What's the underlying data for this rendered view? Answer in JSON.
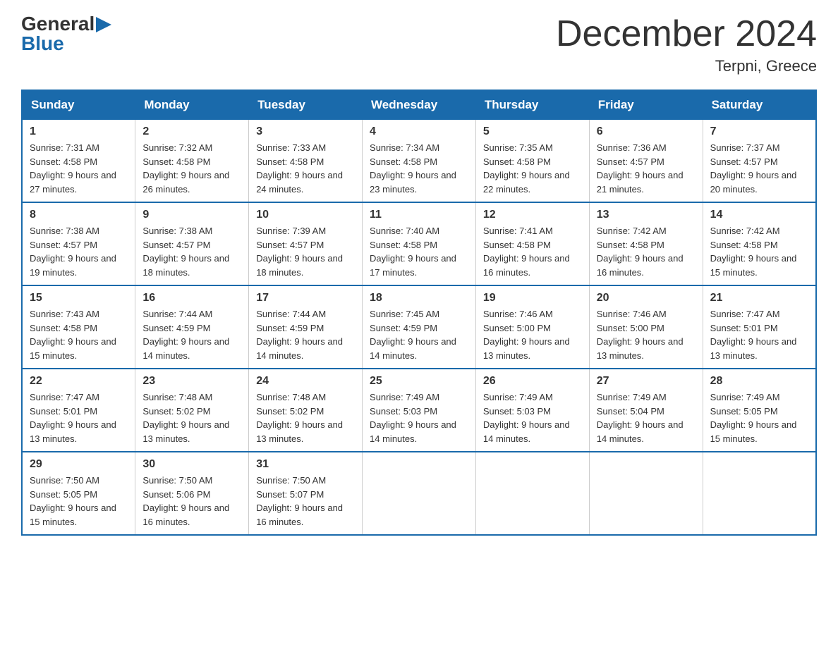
{
  "logo": {
    "general": "General",
    "blue": "Blue",
    "arrow": "▶"
  },
  "title": "December 2024",
  "location": "Terpni, Greece",
  "headers": [
    "Sunday",
    "Monday",
    "Tuesday",
    "Wednesday",
    "Thursday",
    "Friday",
    "Saturday"
  ],
  "weeks": [
    [
      {
        "day": "1",
        "sunrise": "7:31 AM",
        "sunset": "4:58 PM",
        "daylight": "9 hours and 27 minutes."
      },
      {
        "day": "2",
        "sunrise": "7:32 AM",
        "sunset": "4:58 PM",
        "daylight": "9 hours and 26 minutes."
      },
      {
        "day": "3",
        "sunrise": "7:33 AM",
        "sunset": "4:58 PM",
        "daylight": "9 hours and 24 minutes."
      },
      {
        "day": "4",
        "sunrise": "7:34 AM",
        "sunset": "4:58 PM",
        "daylight": "9 hours and 23 minutes."
      },
      {
        "day": "5",
        "sunrise": "7:35 AM",
        "sunset": "4:58 PM",
        "daylight": "9 hours and 22 minutes."
      },
      {
        "day": "6",
        "sunrise": "7:36 AM",
        "sunset": "4:57 PM",
        "daylight": "9 hours and 21 minutes."
      },
      {
        "day": "7",
        "sunrise": "7:37 AM",
        "sunset": "4:57 PM",
        "daylight": "9 hours and 20 minutes."
      }
    ],
    [
      {
        "day": "8",
        "sunrise": "7:38 AM",
        "sunset": "4:57 PM",
        "daylight": "9 hours and 19 minutes."
      },
      {
        "day": "9",
        "sunrise": "7:38 AM",
        "sunset": "4:57 PM",
        "daylight": "9 hours and 18 minutes."
      },
      {
        "day": "10",
        "sunrise": "7:39 AM",
        "sunset": "4:57 PM",
        "daylight": "9 hours and 18 minutes."
      },
      {
        "day": "11",
        "sunrise": "7:40 AM",
        "sunset": "4:58 PM",
        "daylight": "9 hours and 17 minutes."
      },
      {
        "day": "12",
        "sunrise": "7:41 AM",
        "sunset": "4:58 PM",
        "daylight": "9 hours and 16 minutes."
      },
      {
        "day": "13",
        "sunrise": "7:42 AM",
        "sunset": "4:58 PM",
        "daylight": "9 hours and 16 minutes."
      },
      {
        "day": "14",
        "sunrise": "7:42 AM",
        "sunset": "4:58 PM",
        "daylight": "9 hours and 15 minutes."
      }
    ],
    [
      {
        "day": "15",
        "sunrise": "7:43 AM",
        "sunset": "4:58 PM",
        "daylight": "9 hours and 15 minutes."
      },
      {
        "day": "16",
        "sunrise": "7:44 AM",
        "sunset": "4:59 PM",
        "daylight": "9 hours and 14 minutes."
      },
      {
        "day": "17",
        "sunrise": "7:44 AM",
        "sunset": "4:59 PM",
        "daylight": "9 hours and 14 minutes."
      },
      {
        "day": "18",
        "sunrise": "7:45 AM",
        "sunset": "4:59 PM",
        "daylight": "9 hours and 14 minutes."
      },
      {
        "day": "19",
        "sunrise": "7:46 AM",
        "sunset": "5:00 PM",
        "daylight": "9 hours and 13 minutes."
      },
      {
        "day": "20",
        "sunrise": "7:46 AM",
        "sunset": "5:00 PM",
        "daylight": "9 hours and 13 minutes."
      },
      {
        "day": "21",
        "sunrise": "7:47 AM",
        "sunset": "5:01 PM",
        "daylight": "9 hours and 13 minutes."
      }
    ],
    [
      {
        "day": "22",
        "sunrise": "7:47 AM",
        "sunset": "5:01 PM",
        "daylight": "9 hours and 13 minutes."
      },
      {
        "day": "23",
        "sunrise": "7:48 AM",
        "sunset": "5:02 PM",
        "daylight": "9 hours and 13 minutes."
      },
      {
        "day": "24",
        "sunrise": "7:48 AM",
        "sunset": "5:02 PM",
        "daylight": "9 hours and 13 minutes."
      },
      {
        "day": "25",
        "sunrise": "7:49 AM",
        "sunset": "5:03 PM",
        "daylight": "9 hours and 14 minutes."
      },
      {
        "day": "26",
        "sunrise": "7:49 AM",
        "sunset": "5:03 PM",
        "daylight": "9 hours and 14 minutes."
      },
      {
        "day": "27",
        "sunrise": "7:49 AM",
        "sunset": "5:04 PM",
        "daylight": "9 hours and 14 minutes."
      },
      {
        "day": "28",
        "sunrise": "7:49 AM",
        "sunset": "5:05 PM",
        "daylight": "9 hours and 15 minutes."
      }
    ],
    [
      {
        "day": "29",
        "sunrise": "7:50 AM",
        "sunset": "5:05 PM",
        "daylight": "9 hours and 15 minutes."
      },
      {
        "day": "30",
        "sunrise": "7:50 AM",
        "sunset": "5:06 PM",
        "daylight": "9 hours and 16 minutes."
      },
      {
        "day": "31",
        "sunrise": "7:50 AM",
        "sunset": "5:07 PM",
        "daylight": "9 hours and 16 minutes."
      },
      null,
      null,
      null,
      null
    ]
  ],
  "labels": {
    "sunrise": "Sunrise:",
    "sunset": "Sunset:",
    "daylight": "Daylight:"
  }
}
